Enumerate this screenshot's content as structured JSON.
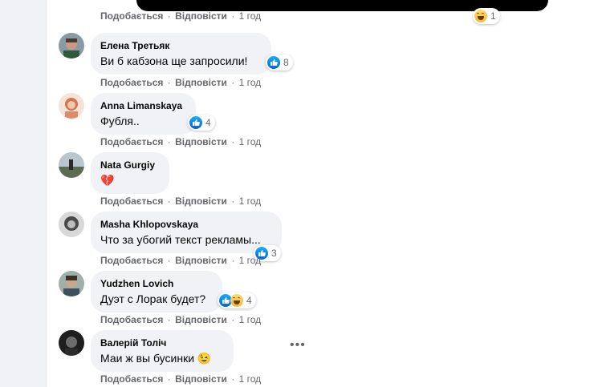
{
  "labels": {
    "like": "Подобається",
    "reply": "Відповісти",
    "sep": "·"
  },
  "top": {
    "time": "1 год",
    "reactions": "1"
  },
  "comments": [
    {
      "name": "Елена Третьяк",
      "text": "Ви б кабзона ще запросили!",
      "reactions": "8",
      "time": "1 год"
    },
    {
      "name": "Anna Limanskaya",
      "text": "Фубля..",
      "reactions": "4",
      "time": "1 год"
    },
    {
      "name": "Nata Gurgiy",
      "text": "💔",
      "reactions": "",
      "time": "1 год"
    },
    {
      "name": "Masha Khlopovskaya",
      "text": "Что за убогий текст рекламы...",
      "reactions": "3",
      "time": "1 год"
    },
    {
      "name": "Yudzhen Lovich",
      "text": "Дуэт с Лорак будет?",
      "reactions": "4",
      "time": "1 год"
    },
    {
      "name": "Валерій Толіч",
      "text": "Маи ж вы бусинки 😉",
      "reactions": "",
      "time": "1 год"
    }
  ],
  "colors": {
    "like": "#1877f2",
    "haha": "#f7c94b",
    "bubble": "#f0f2f5",
    "meta": "#65676b"
  }
}
